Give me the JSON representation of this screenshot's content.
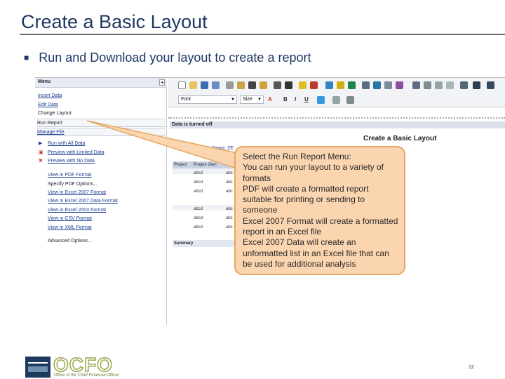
{
  "slide": {
    "title": "Create a Basic Layout",
    "bullet": "Run and Download your layout to create a report",
    "page_number": "12"
  },
  "menu": {
    "header": "Menu",
    "items": [
      {
        "label": "Insert Data"
      },
      {
        "label": "Edit Data"
      },
      {
        "label": "Change Layout"
      },
      {
        "label": "Run Report"
      },
      {
        "label": "Manage File"
      }
    ],
    "run_options": [
      {
        "label": "Run with All Data"
      },
      {
        "label": "Preview with Limited Data"
      },
      {
        "label": "Preview with No Data"
      }
    ],
    "formats": [
      {
        "label": "View in PDF Format"
      },
      {
        "label": "Specify PDF Options..."
      },
      {
        "label": "View in Excel 2007 Format"
      },
      {
        "label": "View in Excel 2007 Data Format"
      },
      {
        "label": "View in Excel 2003 Format"
      },
      {
        "label": "View in CSV Format"
      },
      {
        "label": "View in XML Format"
      }
    ],
    "advanced": "Advanced Options..."
  },
  "toolbar": {
    "font_select": "Font",
    "size_select": "Size"
  },
  "canvas": {
    "data_status": "Data is turned off",
    "report_title": "Create a Basic Layout",
    "suppress_text": "Suppression on Rows: ZE",
    "table": {
      "headers": [
        "Project",
        "Project Own"
      ],
      "rows": [
        [
          "abcd",
          "abc"
        ],
        [
          "abcd",
          "abc"
        ],
        [
          "abcd",
          "abc"
        ],
        [
          "abcd",
          "abc"
        ],
        [
          "abcd",
          "abc"
        ],
        [
          "abcd",
          "abc"
        ]
      ],
      "summary": "Summary"
    }
  },
  "callout": {
    "lines": [
      "Select the Run Report Menu:",
      "You can run your layout to a variety of formats",
      "PDF will create a formatted report suitable for printing or sending to someone",
      "Excel 2007 Format will create a formatted report in an Excel file",
      "Excel 2007 Data will create an unformatted list in an Excel file that can be used for additional analysis"
    ]
  },
  "footer": {
    "logo_text": "OCFO",
    "logo_subtitle": "Office of the Chief Financial Officer"
  },
  "colors": {
    "title": "#1f3864",
    "callout_fill": "#fbd5b0",
    "callout_border": "#e6a762",
    "link": "#1a3d8f"
  }
}
